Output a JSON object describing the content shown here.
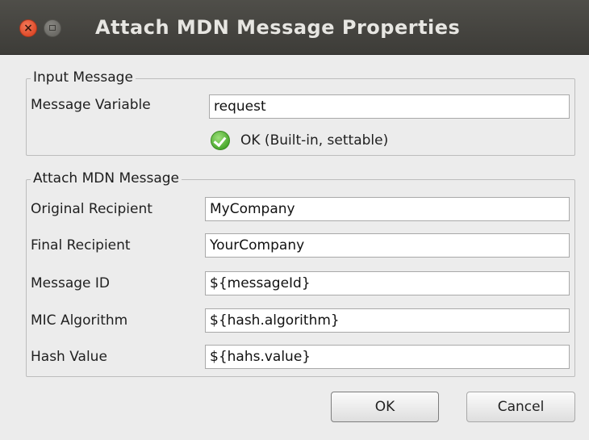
{
  "window": {
    "title": "Attach MDN Message Properties",
    "close_glyph": "×"
  },
  "input_message": {
    "legend": "Input Message",
    "variable_label": "Message Variable",
    "variable_value": "request",
    "status_icon": "check-circle-icon",
    "status_text": "OK (Built-in, settable)"
  },
  "attach_mdn": {
    "legend": "Attach MDN Message",
    "fields": [
      {
        "label": "Original Recipient",
        "value": "MyCompany"
      },
      {
        "label": "Final Recipient",
        "value": "YourCompany"
      },
      {
        "label": "Message ID",
        "value": "${messageId}"
      },
      {
        "label": "MIC Algorithm",
        "value": "${hash.algorithm}"
      },
      {
        "label": "Hash Value",
        "value": "${hahs.value}"
      }
    ]
  },
  "buttons": {
    "ok": "OK",
    "cancel": "Cancel"
  },
  "colors": {
    "titlebar": "#3f3e3a",
    "close": "#e0552f",
    "background": "#ececec",
    "ok_status": "#46a62a"
  }
}
